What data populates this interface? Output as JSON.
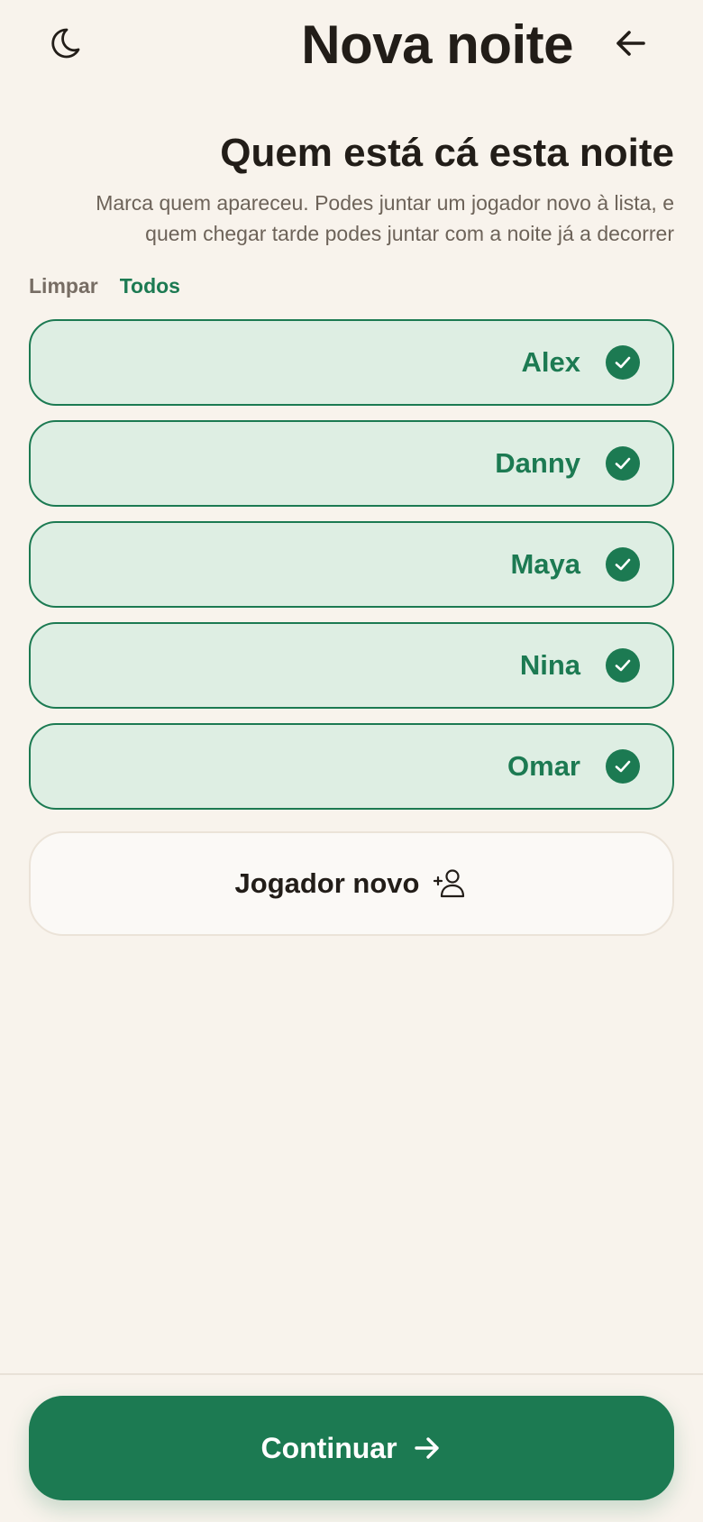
{
  "header": {
    "title": "Nova noite",
    "left_icon": "moon-icon",
    "right_icon": "arrow-left-icon"
  },
  "section": {
    "title": "Quem está cá esta noite",
    "subtitle": "Marca quem apareceu. Podes juntar um jogador novo à lista, e quem chegar tarde podes juntar com a noite já a decorrer"
  },
  "actions": {
    "clear_label": "Limpar",
    "all_label": "Todos"
  },
  "players": [
    {
      "name": "Alex",
      "checked": true
    },
    {
      "name": "Danny",
      "checked": true
    },
    {
      "name": "Maya",
      "checked": true
    },
    {
      "name": "Nina",
      "checked": true
    },
    {
      "name": "Omar",
      "checked": true
    }
  ],
  "new_player": {
    "label": "Jogador novo",
    "icon": "user-plus-icon"
  },
  "footer": {
    "continue_label": "Continuar",
    "icon": "arrow-right-icon"
  },
  "colors": {
    "accent": "#1c7a52",
    "selected_background": "#deeee3",
    "page_background": "#f8f3ec",
    "text_primary": "#221d18",
    "text_muted": "#6d6359"
  }
}
